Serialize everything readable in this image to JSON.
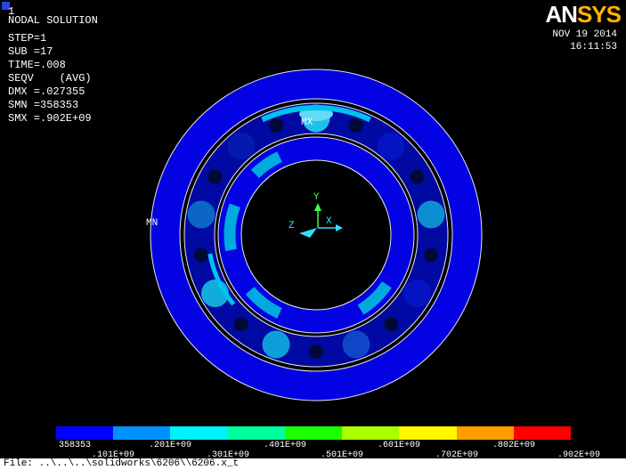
{
  "app": {
    "plot_id": "1",
    "logo": {
      "part1": "AN",
      "part2": "SYS",
      "gold_color": "#ffb400"
    },
    "date": "NOV 19 2014",
    "time": "16:11:53"
  },
  "solution_info": {
    "lines": [
      "NODAL SOLUTION",
      "STEP=1",
      "SUB =17",
      "TIME=.008",
      "SEQV    (AVG)",
      "DMX =.027355",
      "SMN =358353",
      "SMX =.902E+09"
    ]
  },
  "plot": {
    "max_label": "MX",
    "min_label": "MN",
    "triad": {
      "x": "X",
      "y": "Y",
      "z": "Z"
    },
    "triad_colors": {
      "y_axis": "#44ff44",
      "xz_axis": "#2ee0ff"
    }
  },
  "legend": {
    "colors": [
      "#0000ff",
      "#0093ff",
      "#00f2ff",
      "#00ff9c",
      "#1cff00",
      "#a8ff00",
      "#fff600",
      "#ff9c00",
      "#ff0000"
    ],
    "labels": [
      "358353",
      ".101E+09",
      ".201E+09",
      ".301E+09",
      ".401E+09",
      ".501E+09",
      ".601E+09",
      ".702E+09",
      ".802E+09",
      ".902E+09"
    ]
  },
  "status_bar": {
    "text": "File: ..\\..\\..\\solidworks\\6206\\\\6206.x_t"
  }
}
